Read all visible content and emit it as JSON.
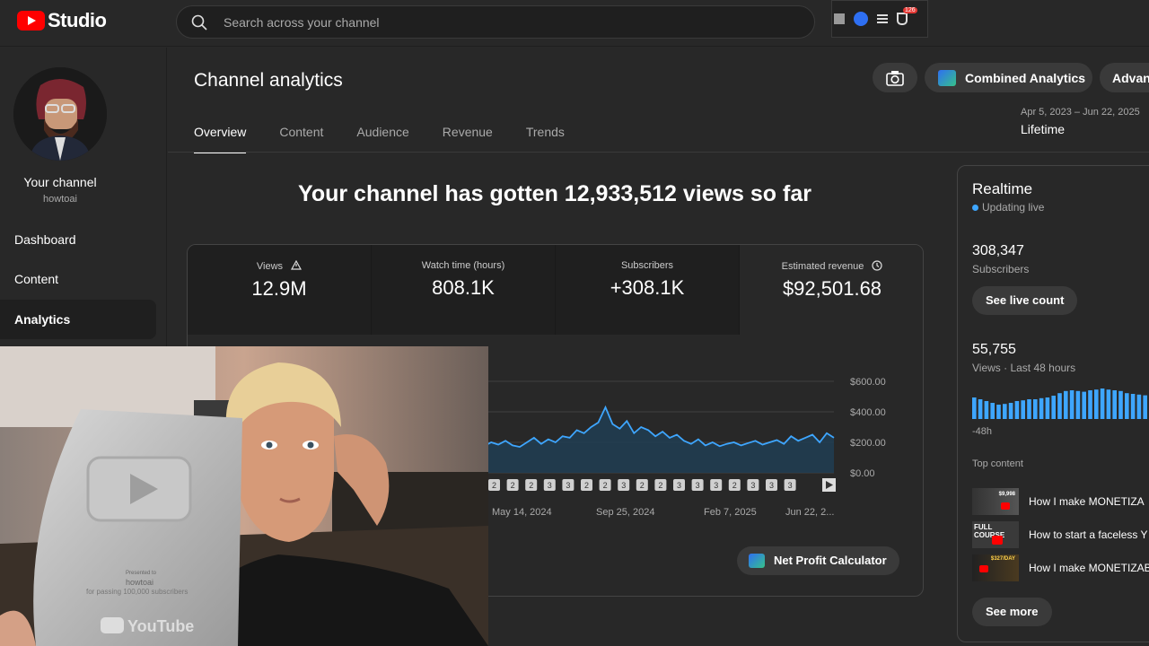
{
  "app": {
    "logo_text": "Studio"
  },
  "search": {
    "placeholder": "Search across your channel"
  },
  "extension": {
    "badge_count": "126"
  },
  "sidebar": {
    "channel_title": "Your channel",
    "channel_handle": "howtoai",
    "items": [
      {
        "label": "Dashboard"
      },
      {
        "label": "Content"
      },
      {
        "label": "Analytics"
      }
    ]
  },
  "header": {
    "title": "Channel analytics",
    "tabs": [
      {
        "label": "Overview"
      },
      {
        "label": "Content"
      },
      {
        "label": "Audience"
      },
      {
        "label": "Revenue"
      },
      {
        "label": "Trends"
      }
    ],
    "combined_label": "Combined Analytics",
    "advanced_label": "Advanc",
    "date_range": "Apr 5, 2023 – Jun 22, 2025",
    "date_label": "Lifetime"
  },
  "overview": {
    "headline": "Your channel has gotten 12,933,512 views so far",
    "metrics": [
      {
        "label": "Views",
        "value": "12.9M"
      },
      {
        "label": "Watch time (hours)",
        "value": "808.1K"
      },
      {
        "label": "Subscribers",
        "value": "+308.1K"
      },
      {
        "label": "Estimated revenue",
        "value": "$92,501.68"
      }
    ],
    "calculator_label": "Net Profit Calculator",
    "markers": [
      "2",
      "2",
      "2",
      "3",
      "3",
      "2",
      "2",
      "3",
      "2",
      "2",
      "3",
      "3",
      "3",
      "2",
      "3",
      "3",
      "3"
    ]
  },
  "chart_data": {
    "type": "area",
    "x_tick_labels": [
      "May 14, 2024",
      "Sep 25, 2024",
      "Feb 7, 2025",
      "Jun 22, 2..."
    ],
    "y_tick_labels": [
      "$600.00",
      "$400.00",
      "$200.00",
      "$0.00"
    ],
    "ylim": [
      0,
      600
    ],
    "series": [
      {
        "values": [
          150,
          140,
          175,
          130,
          165,
          150,
          195,
          140,
          170,
          160,
          180,
          150,
          200,
          165,
          230,
          170,
          190,
          160,
          175,
          155,
          185,
          150,
          170,
          200,
          160,
          185,
          150,
          170,
          160,
          190,
          175,
          165,
          185,
          150,
          200,
          180,
          160,
          205,
          190,
          175,
          200,
          185,
          210,
          180,
          170,
          200,
          230,
          190,
          220,
          200,
          240,
          230,
          280,
          260,
          300,
          330,
          430,
          320,
          290,
          340,
          260,
          300,
          280,
          240,
          270,
          230,
          250,
          210,
          190,
          220,
          180,
          200,
          175,
          190,
          200,
          180,
          195,
          210,
          185,
          200,
          215,
          190,
          240,
          210,
          230,
          250,
          200,
          260,
          230
        ]
      }
    ],
    "grid": true,
    "line_color": "#3ea6ff"
  },
  "realtime": {
    "title": "Realtime",
    "status": "Updating live",
    "subs_value": "308,347",
    "subs_label": "Subscribers",
    "live_btn": "See live count",
    "views_value": "55,755",
    "views_label": "Views · Last 48 hours",
    "axis_label": "-48h",
    "bars": [
      60,
      55,
      50,
      45,
      40,
      42,
      45,
      50,
      52,
      55,
      55,
      58,
      60,
      65,
      72,
      78,
      80,
      78,
      76,
      80,
      82,
      85,
      82,
      80,
      78,
      72,
      70,
      68,
      66
    ],
    "top_title": "Top content",
    "top": [
      {
        "title": "How I make MONETIZA",
        "thumb_text": "$9,998"
      },
      {
        "title": "How to start a faceless Y",
        "thumb_text": "FULL COURSE"
      },
      {
        "title": "How I make MONETIZAB",
        "thumb_text": "$327/DAY"
      }
    ],
    "more_btn": "See more"
  },
  "overlay": {
    "plaque_line1": "Presented to",
    "plaque_line2": "howtoai",
    "plaque_line3": "for passing 100,000 subscribers",
    "plaque_logo": "YouTube"
  }
}
